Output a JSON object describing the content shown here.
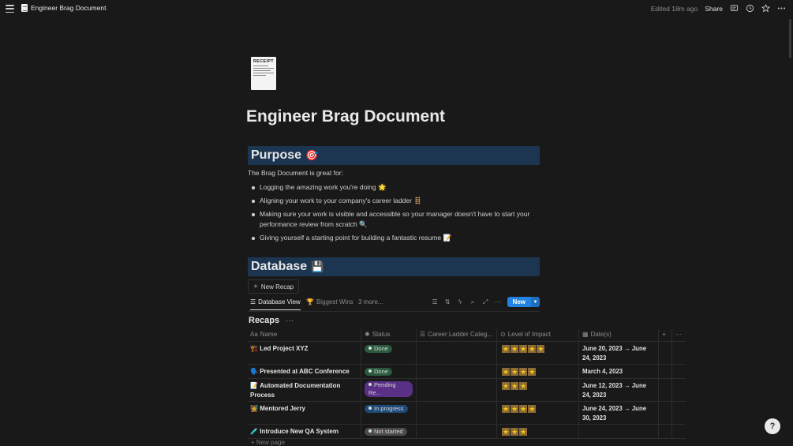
{
  "topbar": {
    "breadcrumb": "Engineer Brag Document",
    "edited": "Edited 18m ago",
    "share": "Share"
  },
  "page": {
    "icon_text": "RECEIPT",
    "title": "Engineer Brag Document"
  },
  "purpose": {
    "heading": "Purpose",
    "emoji": "🎯",
    "intro": "The Brag Document is great for:",
    "bullets": [
      "Logging the amazing work you're doing 🌟",
      "Aligning your work to your company's career ladder 🪜",
      "Making sure your work is visible and accessible so your manager doesn't have to start your performance review from scratch 🔍",
      "Giving yourself a starting point for building a fantastic resume 📝"
    ]
  },
  "database": {
    "heading": "Database",
    "emoji": "💾",
    "new_recap": "New Recap",
    "tabs": [
      "Database View",
      "Biggest Wins",
      "3 more..."
    ],
    "new_button": "New",
    "title": "Recaps",
    "columns": {
      "name": "Name",
      "status": "Status",
      "career": "Career Ladder Categ...",
      "impact": "Level of Impact",
      "dates": "Date(s)"
    },
    "rows": [
      {
        "emoji": "🏗️",
        "name": "Led Project XYZ",
        "status": "Done",
        "stars": 5,
        "dates": "June 20, 2023 → June 24, 2023"
      },
      {
        "emoji": "🗣️",
        "name": "Presented at ABC Conference",
        "status": "Done",
        "stars": 4,
        "dates": "March 4, 2023"
      },
      {
        "emoji": "📝",
        "name": "Automated Documentation Process",
        "status": "Pending Re...",
        "stars": 3,
        "dates": "June 12, 2023 → June 24, 2023"
      },
      {
        "emoji": "🧑‍🏫",
        "name": "Mentored Jerry",
        "status": "In progress",
        "stars": 4,
        "dates": "June 24, 2023 → June 30, 2023"
      },
      {
        "emoji": "🧪",
        "name": "Introduce New QA System",
        "status": "Not started",
        "stars": 3,
        "dates": ""
      }
    ],
    "new_page": "New page"
  },
  "status_colors": {
    "Done": "#2b5a3f",
    "Pending Re...": "#5a2f86",
    "In progress": "#1f4a78",
    "Not started": "#4a4a4a"
  },
  "accent_color": "#2383e2",
  "heading_band_color": "#1c3550"
}
